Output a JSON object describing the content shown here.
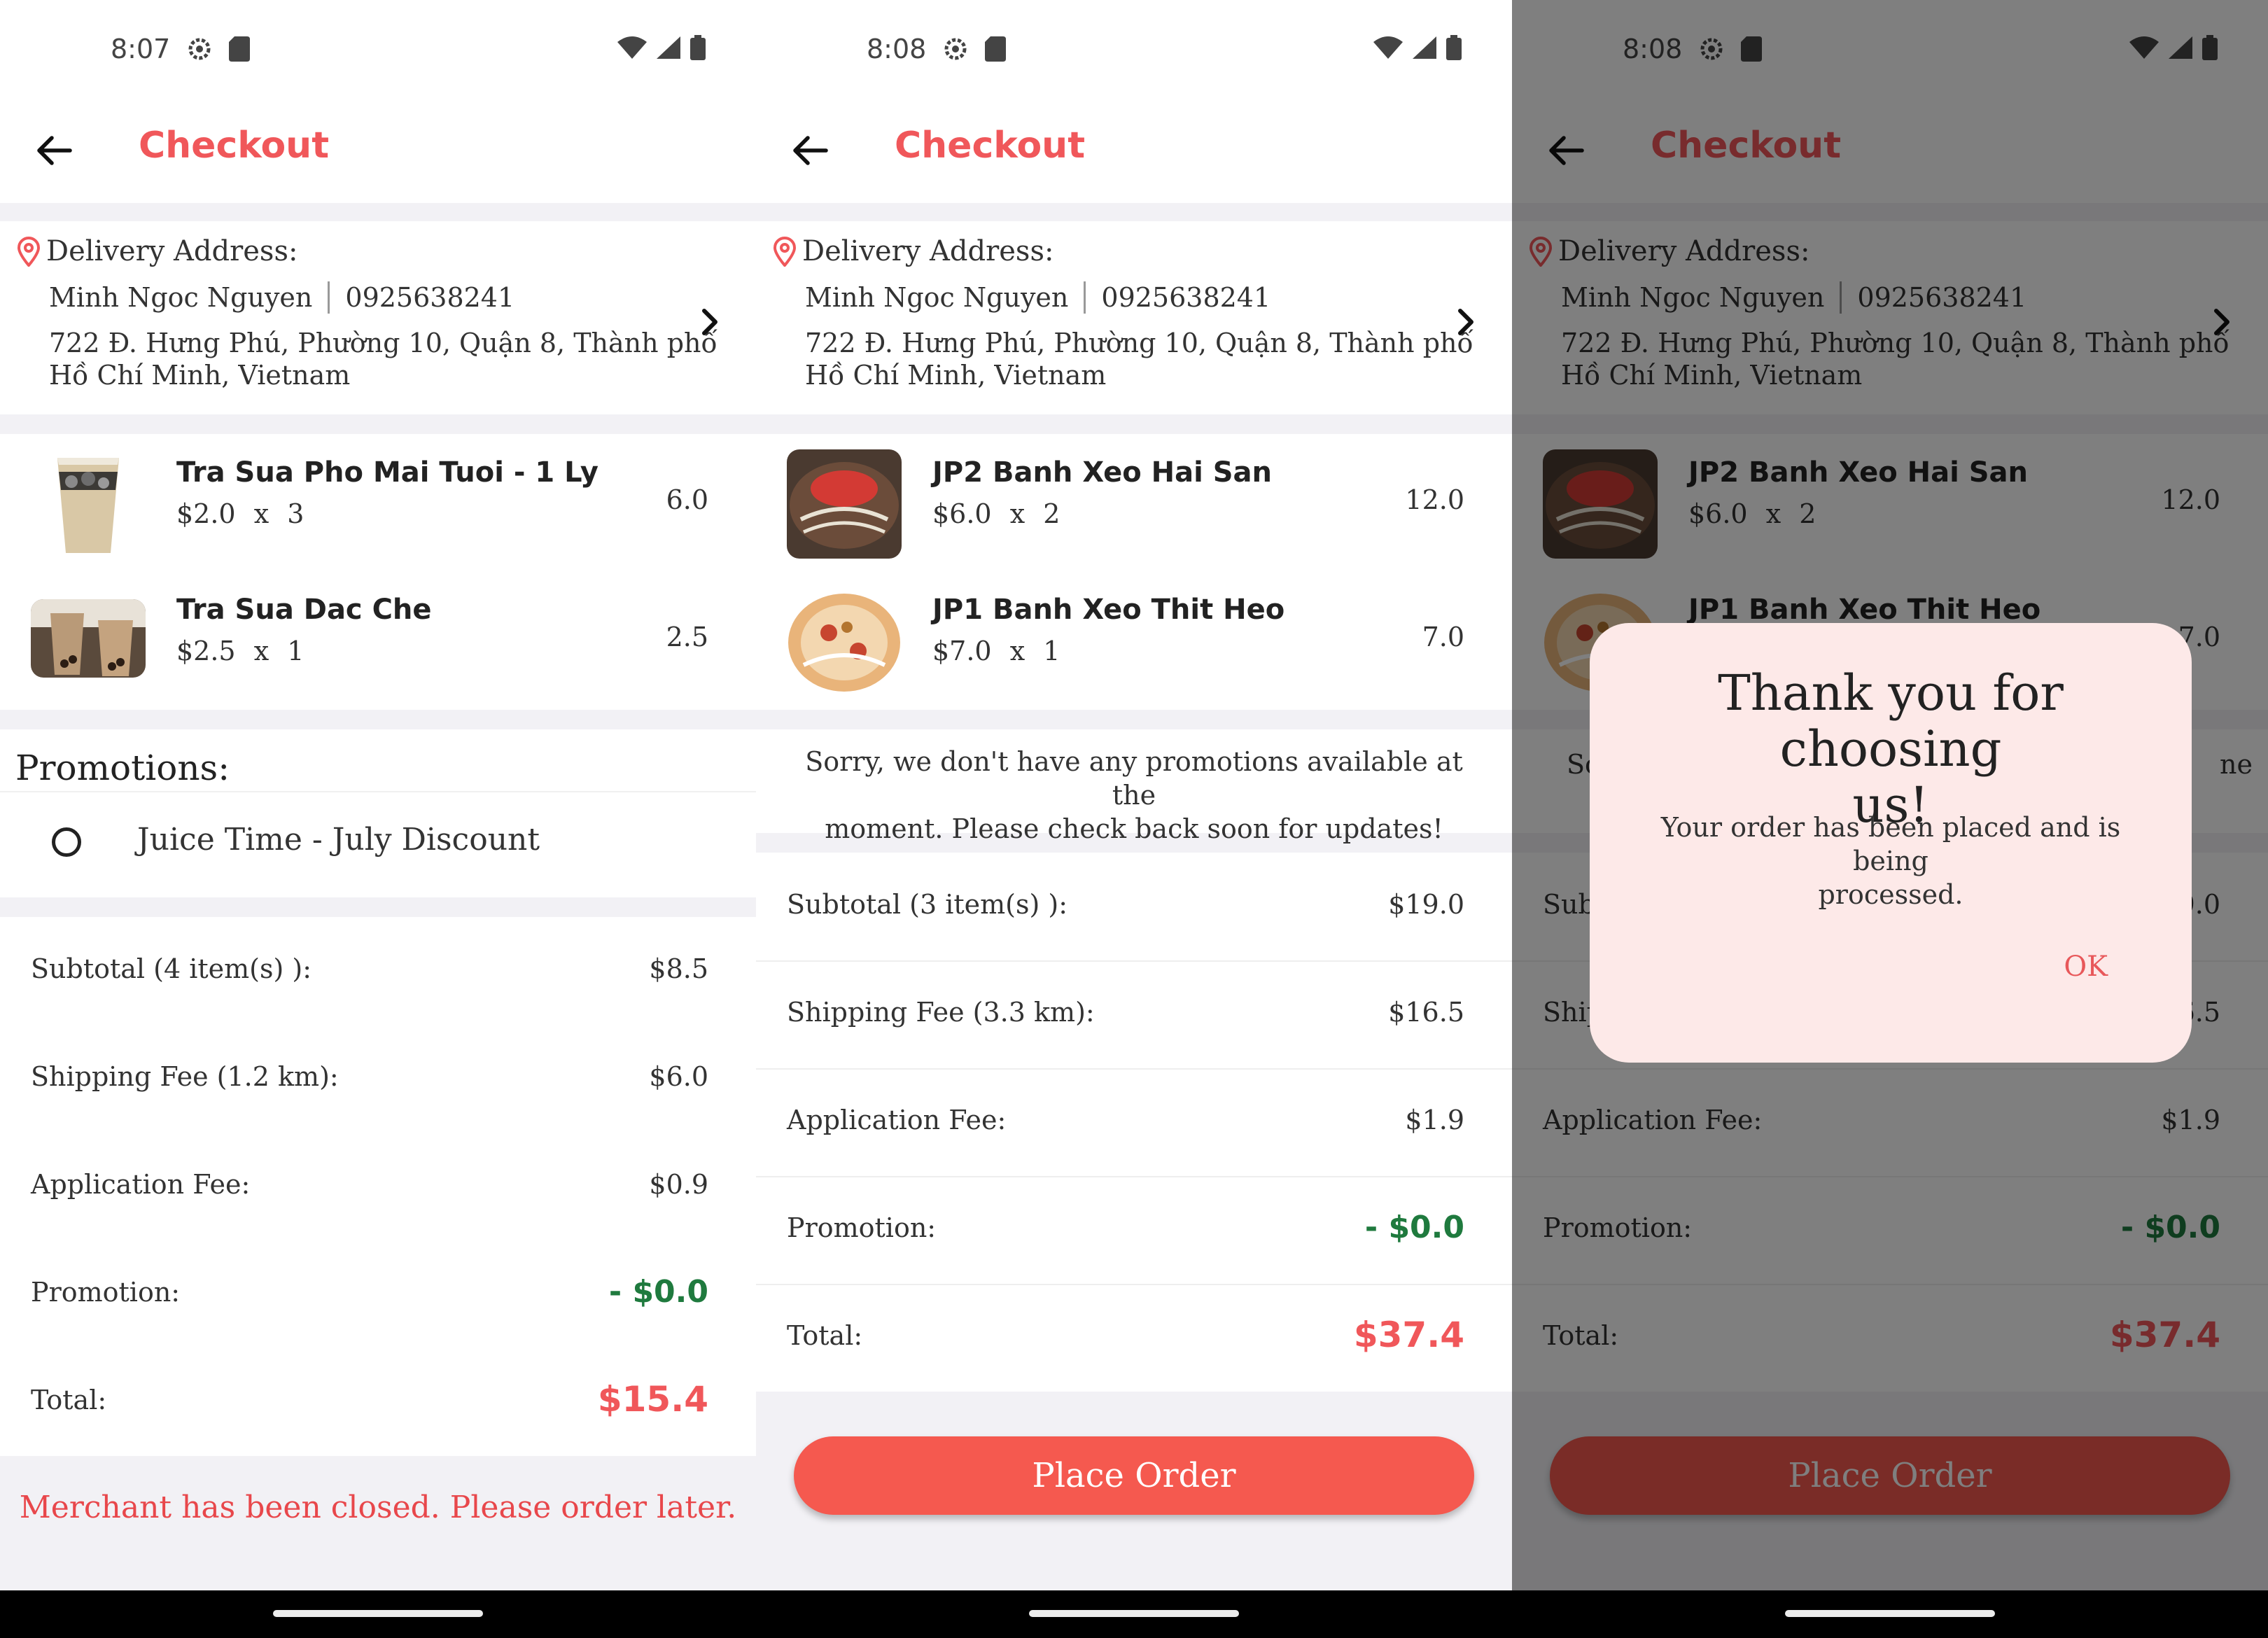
{
  "colors": {
    "accent": "#f0575a",
    "green": "#1f7a3e",
    "button": "#f5594f",
    "dialog": "#fde9e8"
  },
  "screens": [
    {
      "status_time": "8:07",
      "title": "Checkout",
      "address": {
        "label": "Delivery Address:",
        "name": "Minh Ngoc Nguyen",
        "phone": "0925638241",
        "line1": "722 Đ. Hưng Phú, Phường 10, Quận 8, Thành phố",
        "line2": "Hồ Chí Minh, Vietnam"
      },
      "items": [
        {
          "name": "Tra Sua Pho Mai Tuoi - 1 Ly",
          "qty_line": "$2.0 x 3",
          "total": "6.0"
        },
        {
          "name": "Tra Sua Dac Che",
          "qty_line": "$2.5 x 1",
          "total": "2.5"
        }
      ],
      "promotions": {
        "title": "Promotions:",
        "option": "Juice Time - July Discount"
      },
      "summary": {
        "subtotal_label": "Subtotal (4 item(s) ):",
        "subtotal": "$8.5",
        "shipping_label": "Shipping Fee (1.2 km):",
        "shipping": "$6.0",
        "app_fee_label": "Application Fee:",
        "app_fee": "$0.9",
        "promotion_label": "Promotion:",
        "promotion": "- $0.0",
        "total_label": "Total:",
        "total": "$15.4"
      },
      "closed_message": "Merchant has been closed. Please order later."
    },
    {
      "status_time": "8:08",
      "title": "Checkout",
      "address": {
        "label": "Delivery Address:",
        "name": "Minh Ngoc Nguyen",
        "phone": "0925638241",
        "line1": "722 Đ. Hưng Phú, Phường 10, Quận 8, Thành phố",
        "line2": "Hồ Chí Minh, Vietnam"
      },
      "items": [
        {
          "name": "JP2 Banh Xeo Hai San",
          "qty_line": "$6.0 x 2",
          "total": "12.0"
        },
        {
          "name": "JP1 Banh Xeo Thit Heo",
          "qty_line": "$7.0 x 1",
          "total": "7.0"
        }
      ],
      "promotions": {
        "empty_line1": "Sorry, we don't have any promotions available at the",
        "empty_line2": "moment. Please check back soon for updates!"
      },
      "summary": {
        "subtotal_label": "Subtotal (3 item(s) ):",
        "subtotal": "$19.0",
        "shipping_label": "Shipping Fee (3.3 km):",
        "shipping": "$16.5",
        "app_fee_label": "Application Fee:",
        "app_fee": "$1.9",
        "promotion_label": "Promotion:",
        "promotion": "- $0.0",
        "total_label": "Total:",
        "total": "$37.4"
      },
      "place_order_label": "Place Order"
    },
    {
      "status_time": "8:08",
      "title": "Checkout",
      "address": {
        "label": "Delivery Address:",
        "name": "Minh Ngoc Nguyen",
        "phone": "0925638241",
        "line1": "722 Đ. Hưng Phú, Phường 10, Quận 8, Thành phố",
        "line2": "Hồ Chí Minh, Vietnam"
      },
      "items": [
        {
          "name": "JP2 Banh Xeo Hai San",
          "qty_line": "$6.0 x 2",
          "total": "12.0"
        },
        {
          "name": "JP1 Banh Xeo Thit Heo",
          "total": "7.0"
        }
      ],
      "promotions": {
        "peek_left": "So",
        "peek_right": "ne"
      },
      "summary": {
        "subtotal_label": "Sub",
        "subtotal": "9.0",
        "shipping_label": "Ship",
        "shipping": "6.5",
        "app_fee_label": "Application Fee:",
        "app_fee": "$1.9",
        "promotion_label": "Promotion:",
        "promotion": "- $0.0",
        "total_label": "Total:",
        "total": "$37.4"
      },
      "place_order_label": "Place Order",
      "dialog": {
        "title_line1": "Thank you for choosing",
        "title_line2": "us!",
        "body_line1": "Your order has been placed and is being",
        "body_line2": "processed.",
        "ok_label": "OK"
      }
    }
  ]
}
